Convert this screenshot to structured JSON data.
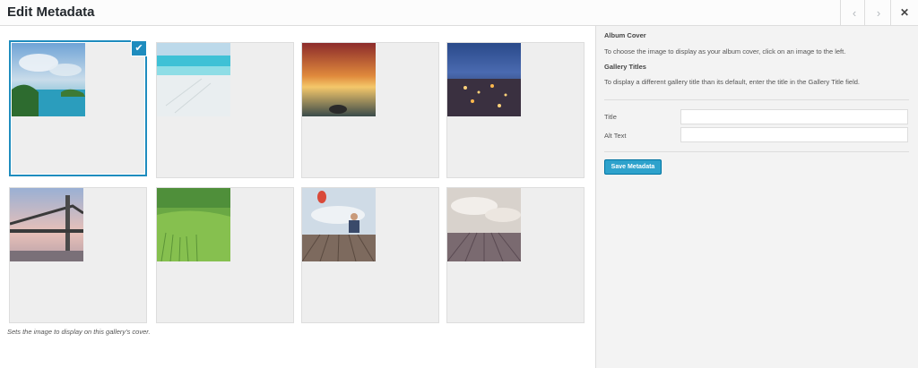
{
  "modal": {
    "title": "Edit Metadata",
    "prev_icon": "chevron-left-icon",
    "next_icon": "chevron-right-icon",
    "close_icon": "close-icon"
  },
  "gallery": {
    "hint": "Sets the image to display on this gallery's cover.",
    "selected_index": 0,
    "images": [
      {
        "name": "tropical-island-lagoon"
      },
      {
        "name": "white-sand-beach"
      },
      {
        "name": "sunset-over-rocky-shore"
      },
      {
        "name": "city-lights-at-night"
      },
      {
        "name": "suspension-bridge-at-dusk"
      },
      {
        "name": "green-wheat-field"
      },
      {
        "name": "person-with-laptop-on-pier-hot-air-balloon"
      },
      {
        "name": "wooden-pier-cloudy-sky"
      }
    ]
  },
  "sidebar": {
    "album_cover_heading": "Album Cover",
    "album_cover_text": "To choose the image to display as your album cover, click on an image to the left.",
    "gallery_titles_heading": "Gallery Titles",
    "gallery_titles_text": "To display a different gallery title than its default, enter the title in the Gallery Title field.",
    "title_label": "Title",
    "title_value": "",
    "alt_label": "Alt Text",
    "alt_value": "",
    "save_label": "Save Metadata"
  },
  "colors": {
    "accent": "#1e8cbe",
    "button": "#2ea2cc"
  }
}
